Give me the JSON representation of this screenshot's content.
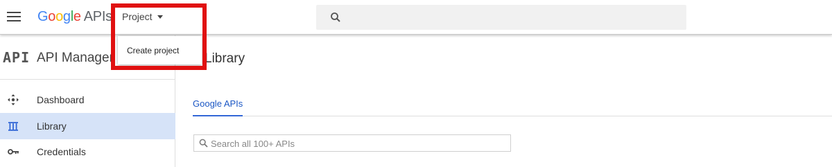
{
  "header": {
    "logo_letters": [
      "G",
      "o",
      "o",
      "g",
      "l",
      "e"
    ],
    "logo_suffix": "APIs",
    "project_label": "Project",
    "search_placeholder": ""
  },
  "project_menu": {
    "items": [
      {
        "label": "Create project"
      }
    ]
  },
  "sidebar": {
    "api_mark": "API",
    "title": "API Manager",
    "items": [
      {
        "label": "Dashboard",
        "icon": "dashboard-icon",
        "active": false
      },
      {
        "label": "Library",
        "icon": "library-icon",
        "active": true
      },
      {
        "label": "Credentials",
        "icon": "key-icon",
        "active": false
      }
    ]
  },
  "main": {
    "title": "Library",
    "tabs": [
      {
        "label": "Google APIs",
        "active": true
      }
    ],
    "search_placeholder": "Search all 100+ APIs"
  },
  "annotation": {
    "color": "#e01010"
  },
  "colors": {
    "accent": "#3367d6",
    "active_nav_bg": "#d6e3f8"
  }
}
